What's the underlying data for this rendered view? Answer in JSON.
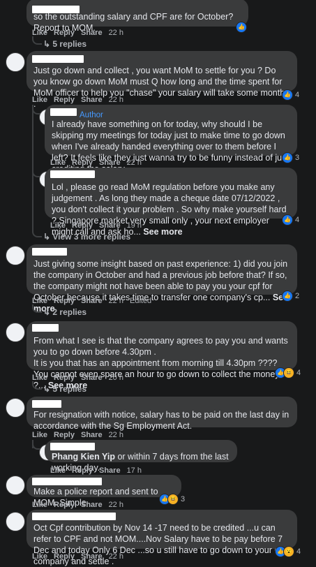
{
  "actions": {
    "like": "Like",
    "reply": "Reply",
    "share": "Share"
  },
  "comments": [
    {
      "text": "so the outstanding salary and CPF are for October? Report to MOM.",
      "time": "22 h",
      "reactions": ""
    },
    {
      "replies_link": "5 replies"
    },
    {
      "text": "Just go down and collect , you want MoM to settle for you ? Do you know go down MoM must Q how long and the time spent for MoM officer to help you \"chase\" your salary will take some months .",
      "time": "22 h",
      "reactions": "4"
    },
    {
      "author_tag": "Author",
      "text": "I already have something on for today, why should I be skipping my meetings for today just to make time to go down when I've already handed everything over to them before I left? It feels like they just wanna try to be funny instead of just crediting the salary.",
      "time": "22 h",
      "reactions": "3"
    },
    {
      "text": "Lol , please go read MoM regulation before you make any judgement . As long they made a cheque date 07/12/2022 , you don't collect it your problem . So why make yourself hard ? Singapore market very small only , your next employer might call and ask ho...",
      "see_more": "See more",
      "time": "19 h",
      "reactions": "4"
    },
    {
      "replies_link": "View 3 more replies"
    },
    {
      "text": "Just giving some insight based on past experience: 1) did you join the company in October and had a previous job before that? If so, the company might not have been able to pay you your cpf for October because it takes time to transfer one company's cp...",
      "see_more": "See more",
      "time": "22 h",
      "edited": "Edited",
      "reactions": "2"
    },
    {
      "replies_link": "2 replies"
    },
    {
      "text_lines": [
        "From what I see is that the company agrees to pay you and wants you to go down before 4.30pm .",
        "It is you that has an appointment from morning till 4.30pm ????",
        "You cannot even spare an hour to go down to collect the money ?..."
      ],
      "see_more": "See more",
      "time": "20 h",
      "reactions": "4"
    },
    {
      "replies_link": "5 replies"
    },
    {
      "text": "For resignation with notice, salary has to be paid on the last day in accordance with the Sg Employment Act.",
      "time": "22 h",
      "reactions": ""
    },
    {
      "mention": "Phang Kien Yip",
      "text": " or within 7 days from the last working day.",
      "time": "17 h",
      "reactions": ""
    },
    {
      "text": "Make a police report and sent to MOM. Simple",
      "time": "22 h",
      "reactions": "3"
    },
    {
      "text": "Oct Cpf contribution by Nov 14 -17 need to be credited ...u can refer to CPF and not MOM....Nov Salary have to be pay before 7 Dec and today Only 6 Dec ...so u still have to go down to your ex company and settle .",
      "time": "22 h",
      "reactions": "4"
    }
  ],
  "icons": {
    "like": "like-reaction-icon",
    "haha": "haha-reaction-icon"
  },
  "colors": {
    "background": "#18191a",
    "bubble": "#3a3b3c",
    "author": "#4599ff",
    "like": "#1877f2"
  }
}
